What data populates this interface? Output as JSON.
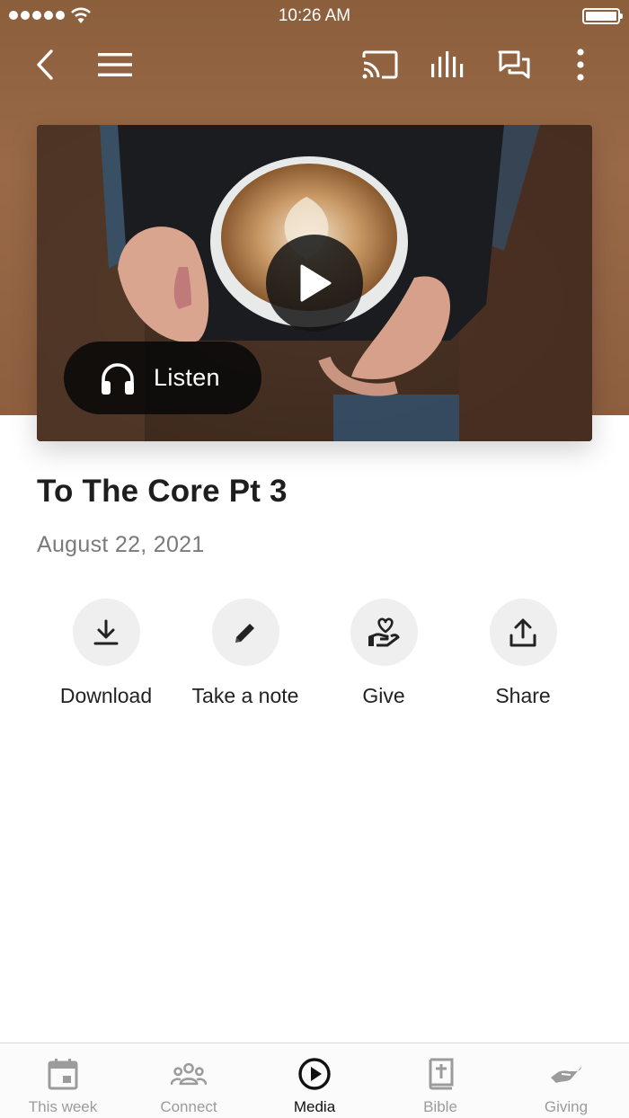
{
  "status_bar": {
    "time": "10:26 AM"
  },
  "toolbar": {
    "icons": [
      "back-icon",
      "menu-icon",
      "cast-icon",
      "audio-bars-icon",
      "chat-icon",
      "more-vert-icon"
    ]
  },
  "media": {
    "listen_label": "Listen",
    "title": "To The Core Pt 3",
    "date": "August 22, 2021"
  },
  "actions": [
    {
      "label": "Download",
      "icon": "download-icon"
    },
    {
      "label": "Take a note",
      "icon": "pencil-icon"
    },
    {
      "label": "Give",
      "icon": "give-heart-hand-icon"
    },
    {
      "label": "Share",
      "icon": "share-upload-icon"
    }
  ],
  "tabs": [
    {
      "label": "This week",
      "icon": "calendar-icon",
      "active": false
    },
    {
      "label": "Connect",
      "icon": "group-icon",
      "active": false
    },
    {
      "label": "Media",
      "icon": "play-circle-icon",
      "active": true
    },
    {
      "label": "Bible",
      "icon": "bible-icon",
      "active": false
    },
    {
      "label": "Giving",
      "icon": "giving-hand-icon",
      "active": false
    }
  ],
  "colors": {
    "header_brown": "#8b5e3c",
    "active_tab": "#111111",
    "inactive_tab": "#9b9b9b",
    "action_circle": "#efefef"
  }
}
